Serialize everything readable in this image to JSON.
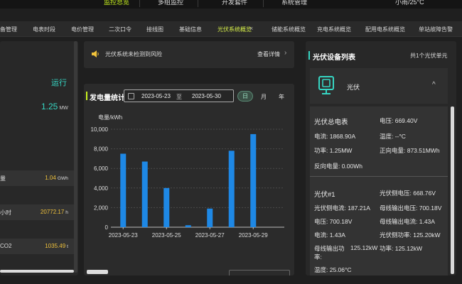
{
  "topbar": {
    "items": [
      "监控总览",
      "多组监控",
      "开发套件",
      "系统管理"
    ],
    "weather": "小雨/25°C"
  },
  "nav": {
    "items": [
      "备管理",
      "电表时段",
      "电价管理",
      "二次口令",
      "接线图",
      "基础信息",
      "光伏系统概览",
      "储能系统概览",
      "充电系统概览",
      "配用电系统概览",
      "单站故障告警"
    ],
    "close": "×"
  },
  "left": {
    "status": "运行",
    "power_value": "1.25",
    "power_unit": "MW",
    "rows": [
      {
        "key": "量",
        "value": "1.04",
        "unit": "GWh"
      },
      {
        "key": "小时",
        "value": "20772.17",
        "unit": "h"
      },
      {
        "key": "CO2",
        "value": "1035.49",
        "unit": "t"
      }
    ]
  },
  "alert": {
    "text": "光伏系统未检测到风险",
    "link": "查看详情",
    "chevron": "›"
  },
  "stats": {
    "title": "发电量统计",
    "date_start": "2023-05-23",
    "date_sep": "至",
    "date_end": "2023-05-30",
    "chip_day": "日",
    "chip_month": "月",
    "chip_year": "年"
  },
  "chart_data": {
    "type": "bar",
    "ylabel": "电量/kWh",
    "ylim": [
      0,
      10000
    ],
    "yticks": [
      "0",
      "2,000",
      "4,000",
      "6,000",
      "8,000",
      "10,000"
    ],
    "categories": [
      "2023-05-23",
      "2023-05-24",
      "2023-05-25",
      "2023-05-26",
      "2023-05-27",
      "2023-05-28",
      "2023-05-29",
      "2023-05-30"
    ],
    "xticklabels": [
      "2023-05-23",
      "2023-05-25",
      "2023-05-27",
      "2023-05-29"
    ],
    "values": [
      7500,
      6700,
      4000,
      200,
      1900,
      7800,
      9500
    ],
    "bar_color": "#1e88e5",
    "grid": true
  },
  "right": {
    "title": "光伏设备列表",
    "count": "共1个光伏单元",
    "unit_name": "光伏",
    "caret": "^",
    "meter": {
      "head": "光伏总电表",
      "voltage": "电压: 669.40V",
      "current": "电流: 1868.90A",
      "temperature": "温度: --°C",
      "power": "功率: 1.25MW",
      "forward_energy": "正向电量: 873.51MWh",
      "reverse_energy": "反向电量: 0.00Wh"
    },
    "inverter": {
      "head": "光伏#1",
      "pv_side_voltage": "光伏侧电压: 668.76V",
      "pv_side_current": "光伏侧电流: 187.21A",
      "bus_out_voltage": "母线输出电压: 700.18V",
      "voltage": "电压: 700.18V",
      "bus_out_current": "母线输出电流: 1.43A",
      "current": "电流: 1.43A",
      "pv_side_power": "光伏侧功率: 125.20kW",
      "bus_out_power_1": "母线输出功",
      "bus_out_power_2": "率:",
      "bus_out_power_value": "125.12kW",
      "power": "功率: 125.12kW",
      "temperature": "温度: 25.06°C"
    }
  }
}
